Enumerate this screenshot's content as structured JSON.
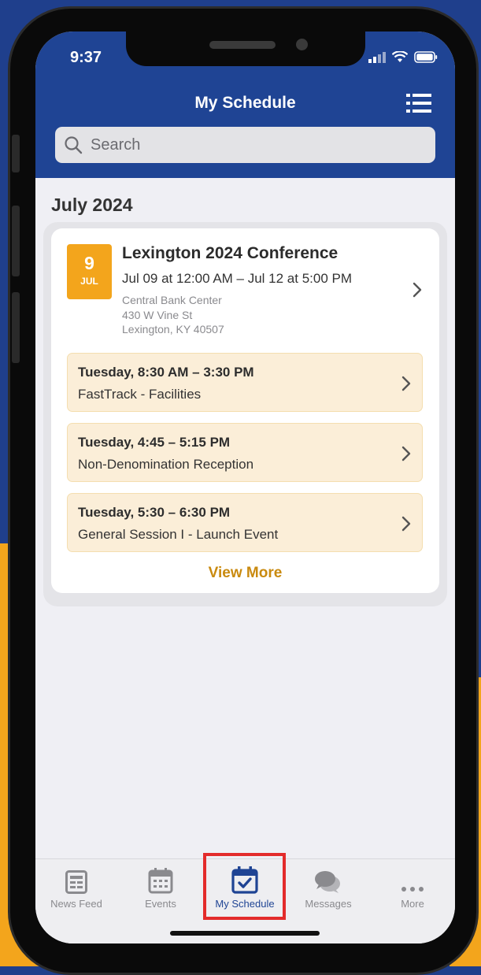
{
  "status": {
    "time": "9:37"
  },
  "header": {
    "title": "My Schedule",
    "search_placeholder": "Search"
  },
  "schedule": {
    "month": "July 2024",
    "event": {
      "badge_day": "9",
      "badge_month": "JUL",
      "title": "Lexington 2024 Conference",
      "datetime": "Jul 09 at 12:00 AM – Jul 12 at 5:00 PM",
      "venue": "Central Bank Center",
      "address1": "430 W Vine St",
      "address2": "Lexington, KY 40507"
    },
    "sessions": [
      {
        "time": "Tuesday, 8:30 AM – 3:30 PM",
        "name": "FastTrack - Facilities"
      },
      {
        "time": "Tuesday, 4:45 – 5:15 PM",
        "name": "Non-Denomination Reception"
      },
      {
        "time": "Tuesday, 5:30 – 6:30 PM",
        "name": "General Session I - Launch Event"
      }
    ],
    "view_more": "View More"
  },
  "tabbar": {
    "tabs": [
      {
        "label": "News Feed",
        "icon": "news-feed-icon"
      },
      {
        "label": "Events",
        "icon": "calendar-icon"
      },
      {
        "label": "My Schedule",
        "icon": "calendar-check-icon",
        "active": true
      },
      {
        "label": "Messages",
        "icon": "chat-bubbles-icon"
      },
      {
        "label": "More",
        "icon": "ellipsis-icon"
      }
    ]
  },
  "colors": {
    "header": "#1f4494",
    "accent": "#f3a51c",
    "session_bg": "#fbeed8",
    "view_more": "#c98a0f",
    "highlight": "#e32b2b"
  }
}
